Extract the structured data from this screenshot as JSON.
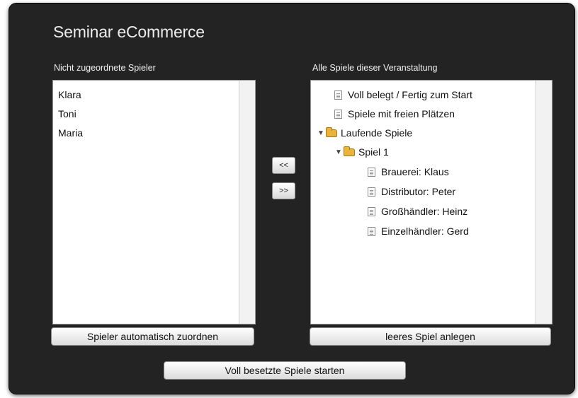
{
  "window": {
    "title": "Seminar eCommerce"
  },
  "left_panel": {
    "label": "Nicht zugeordnete Spieler",
    "players": [
      "Klara",
      "Toni",
      "Maria"
    ],
    "button": "Spieler automatisch zuordnen"
  },
  "transfer": {
    "left": "<<",
    "right": ">>"
  },
  "right_panel": {
    "label": "Alle Spiele dieser Veranstaltung",
    "tree": {
      "full": "Voll belegt / Fertig zum Start",
      "free": "Spiele mit freien Plätzen",
      "running": "Laufende Spiele",
      "game": "Spiel 1",
      "roles": [
        "Brauerei: Klaus",
        "Distributor: Peter",
        "Großhändler: Heinz",
        "Einzelhändler: Gerd"
      ]
    },
    "button": "leeres Spiel anlegen"
  },
  "start_button": "Voll besetzte Spiele starten"
}
